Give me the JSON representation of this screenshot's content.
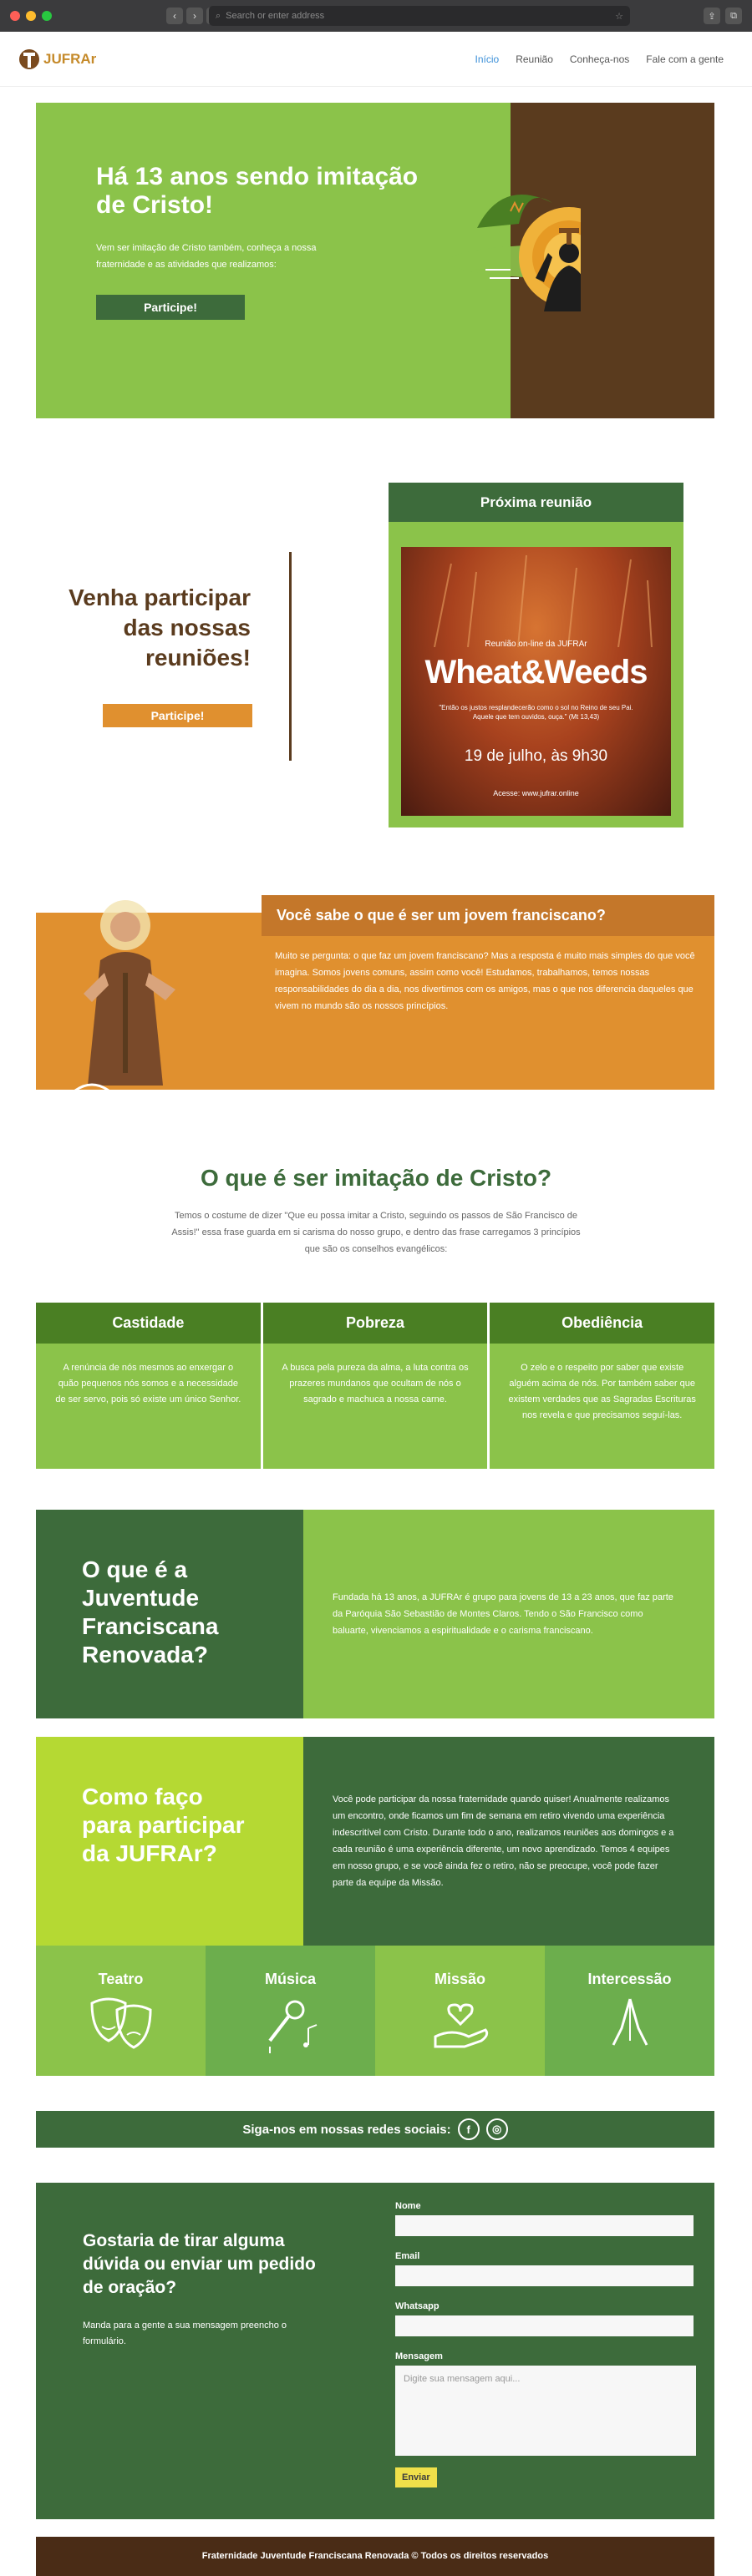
{
  "browser": {
    "url_placeholder": "Search or enter address"
  },
  "nav": {
    "logo": "JUFRAr",
    "items": [
      "Início",
      "Reunião",
      "Conheça-nos",
      "Fale com a gente"
    ]
  },
  "hero": {
    "title": "Há 13 anos sendo imitação de Cristo!",
    "text": "Vem ser imitação de Cristo também, conheça a nossa fraternidade e as atividades que realizamos:",
    "button": "Participe!"
  },
  "reuniao": {
    "title": "Venha participar das nossas reuniões!",
    "button": "Participe!",
    "card_title": "Próxima reunião",
    "poster": {
      "pre": "Reunião on-line da JUFRAr",
      "name": "Wheat&Weeds",
      "quote": "\"Então os justos resplandecerão como o sol no Reino de seu Pai. Aquele que tem ouvidos, ouça.\" (Mt 13,43)",
      "date": "19 de julho, às 9h30",
      "acesse": "Acesse: www.jufrar.online"
    }
  },
  "franciscano": {
    "title": "Você sabe o que é ser um jovem franciscano?",
    "text": "Muito se pergunta: o que faz um jovem franciscano? Mas a resposta é muito mais simples do que você imagina. Somos jovens comuns, assim como você! Estudamos, trabalhamos, temos nossas responsabilidades do dia a dia, nos divertimos com os amigos, mas o que nos diferencia daqueles que vivem no mundo são os nossos princípios."
  },
  "imitacao": {
    "title": "O que é ser imitação de Cristo?",
    "intro": "Temos o costume de dizer \"Que eu possa imitar a Cristo, seguindo os passos de São Francisco de Assis!\" essa frase guarda em si carisma do nosso grupo, e dentro das frase carregamos 3 princípios que são os conselhos evangélicos:",
    "virtues": [
      {
        "name": "Castidade",
        "text": "A renúncia de nós mesmos ao enxergar o quão pequenos nós somos e a necessidade de ser servo, pois só existe um único Senhor."
      },
      {
        "name": "Pobreza",
        "text": "A busca pela pureza da alma, a luta contra os prazeres mundanos que ocultam de nós o sagrado e machuca a nossa carne."
      },
      {
        "name": "Obediência",
        "text": "O zelo e o respeito por saber que existe alguém acima de nós. Por também saber que existem verdades que as Sagradas Escrituras nos revela e que precisamos seguí-las."
      }
    ]
  },
  "jufra": {
    "title": "O que é a Juventude Franciscana Renovada?",
    "text": "Fundada há 13 anos, a JUFRAr é grupo para jovens de 13 a 23 anos, que faz parte da Paróquia São Sebastião de Montes Claros. Tendo o São Francisco como baluarte, vivenciamos a espiritualidade e o carisma franciscano."
  },
  "participar": {
    "title": "Como faço para participar da JUFRAr?",
    "text": "Você pode participar da nossa fraternidade quando quiser! Anualmente realizamos um encontro, onde ficamos um fim de semana em retiro vivendo uma experiência indescritível com Cristo. Durante todo o ano, realizamos reuniões aos domingos e a cada reunião é uma experiência diferente, um novo aprendizado. Temos 4 equipes em nosso grupo, e se você ainda fez o retiro, não se preocupe, você pode fazer parte da equipe da Missão."
  },
  "atividades": [
    {
      "name": "Teatro",
      "icon": "theater-masks-icon"
    },
    {
      "name": "Música",
      "icon": "microphone-music-icon"
    },
    {
      "name": "Missão",
      "icon": "hand-heart-icon"
    },
    {
      "name": "Intercessão",
      "icon": "praying-hands-icon"
    }
  ],
  "social": {
    "text": "Siga-nos em nossas redes sociais:"
  },
  "contato": {
    "title": "Gostaria de tirar alguma dúvida ou enviar um pedido de oração?",
    "text": "Manda para a gente a sua mensagem preencho o formulário.",
    "labels": {
      "nome": "Nome",
      "email": "Email",
      "whatsapp": "Whatsapp",
      "mensagem": "Mensagem"
    },
    "placeholder": "Digite sua mensagem aqui...",
    "button": "Enviar"
  },
  "footer": "Fraternidade Juventude Franciscana Renovada © Todos os direitos reservados",
  "colors": {
    "green_light": "#8bc34a",
    "green_dark": "#3d6b3b",
    "brown": "#5a3b1e",
    "orange": "#e0902f"
  }
}
